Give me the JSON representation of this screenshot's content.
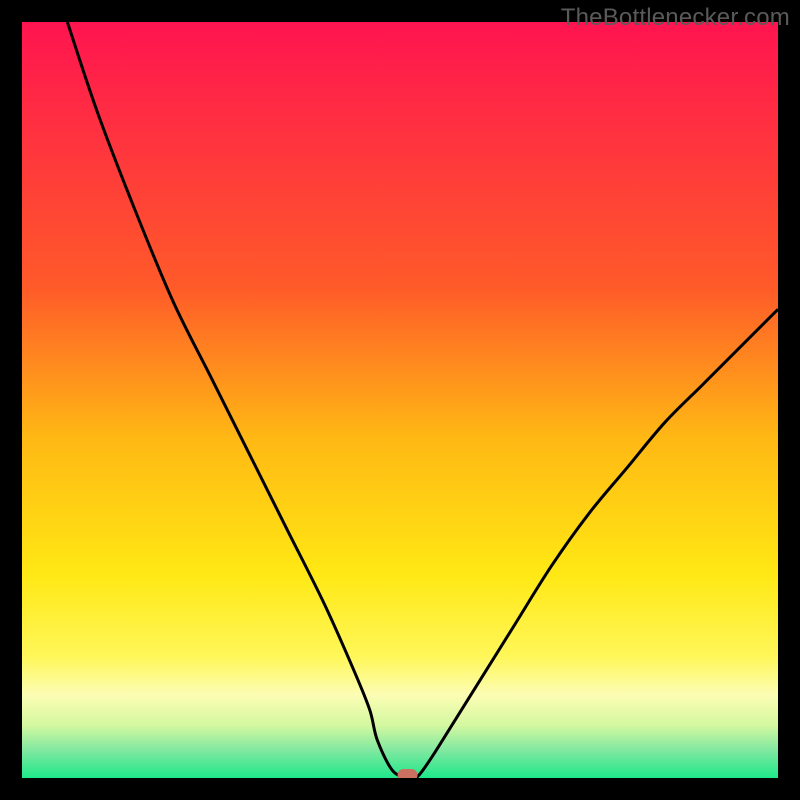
{
  "attribution": "TheBottlenecker.com",
  "chart_data": {
    "type": "line",
    "title": "",
    "xlabel": "",
    "ylabel": "",
    "xlim": [
      0,
      100
    ],
    "ylim": [
      0,
      100
    ],
    "x": [
      6,
      10,
      15,
      20,
      25,
      30,
      35,
      40,
      44,
      46,
      47,
      49,
      51,
      52,
      53,
      55,
      60,
      65,
      70,
      75,
      80,
      85,
      90,
      95,
      100
    ],
    "y": [
      100,
      88,
      75,
      63,
      53,
      43,
      33,
      23,
      14,
      9,
      5,
      1,
      0,
      0,
      1,
      4,
      12,
      20,
      28,
      35,
      41,
      47,
      52,
      57,
      62
    ],
    "minimum_marker": {
      "x": 51,
      "y": 0
    },
    "gradient_stops": [
      {
        "offset": 0.0,
        "color": "#ff1450"
      },
      {
        "offset": 0.35,
        "color": "#ff5a29"
      },
      {
        "offset": 0.55,
        "color": "#ffb814"
      },
      {
        "offset": 0.73,
        "color": "#ffe814"
      },
      {
        "offset": 0.84,
        "color": "#fff75a"
      },
      {
        "offset": 0.89,
        "color": "#fcfdb4"
      },
      {
        "offset": 0.93,
        "color": "#d4f8a0"
      },
      {
        "offset": 0.965,
        "color": "#7ce8a0"
      },
      {
        "offset": 1.0,
        "color": "#1ee88a"
      }
    ]
  }
}
